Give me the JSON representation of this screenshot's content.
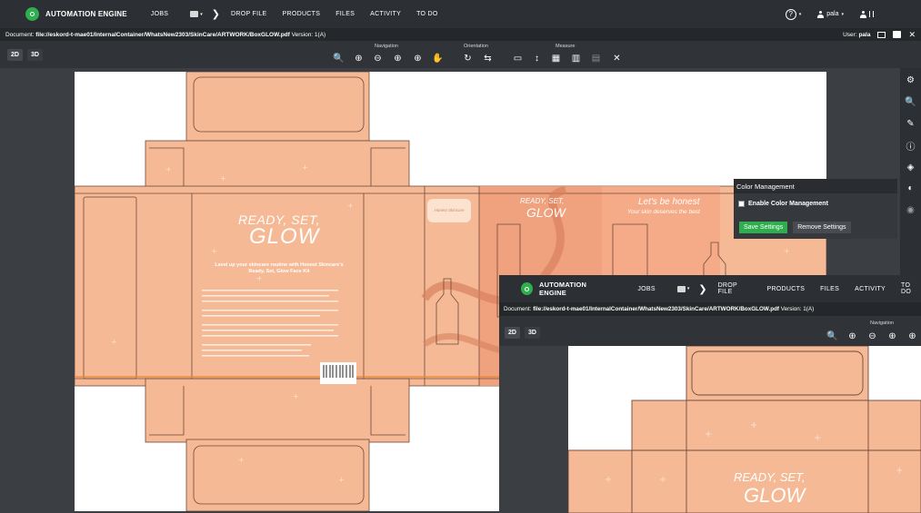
{
  "app": {
    "logo_text": "AUTOMATION ENGINE",
    "nav": [
      "JOBS",
      "DROP FILE",
      "PRODUCTS",
      "FILES",
      "ACTIVITY",
      "TO DO"
    ],
    "user": "pala",
    "chevron": "❯",
    "help_glyph": "?",
    "caret": "▾"
  },
  "docbar": {
    "label": "Document:",
    "path": "file://eskord-t-mae01/InternalContainer/WhatsNew2303/SkinCare/ARTWORK/BoxGLOW.pdf",
    "version": "Version: 1(A)",
    "user_label": "User:",
    "user": "pala",
    "close": "✕"
  },
  "toolbar": {
    "view_2d": "2D",
    "view_3d": "3D",
    "groups": [
      "Navigation",
      "Orientation",
      "Measure"
    ],
    "nav_icons": [
      "🔍",
      "⊕",
      "⊖",
      "⊕",
      "⊕",
      "✋"
    ],
    "orient_icons": [
      "↻",
      "⇆"
    ],
    "measure_icons": [
      "▭",
      "↕",
      "▦",
      "▥",
      "▤",
      "✕"
    ]
  },
  "rightbar_icons": [
    "⚙",
    "🔍",
    "✎",
    "ⓘ",
    "◈",
    "◐",
    "◉"
  ],
  "artwork": {
    "headline_top": "READY, SET,",
    "headline": "GLOW",
    "tagline": "Level up your skincare routine with Honest Skincare's Ready, Set, Glow Face Kit",
    "side_top": "READY, SET,",
    "side_headline": "GLOW",
    "honest_title": "Let's be honest",
    "honest_sub": "Your skin deserves the best",
    "brand": "Honest Skincare"
  },
  "color_mgmt": {
    "title": "Color Management",
    "checkbox": "Enable Color Management",
    "save": "Save Settings",
    "remove": "Remove Settings"
  },
  "inset": {
    "logo_text": "AUTOMATION ENGINE",
    "nav": [
      "JOBS",
      "DROP FILE",
      "PRODUCTS",
      "FILES",
      "ACTIVITY",
      "TO DO"
    ],
    "doc_label": "Document:",
    "doc_path": "file://eskord-t-mae01/InternalContainer/WhatsNew2303/SkinCare/ARTWORK/BoxGLOW.pdf",
    "version": "Version: 1(A)",
    "view_2d": "2D",
    "view_3d": "3D",
    "nav_label": "Navigation",
    "chevron": "❯",
    "nav_icons": [
      "🔍",
      "⊕",
      "⊖",
      "⊕",
      "⊕"
    ],
    "headline_top": "READY, SET,",
    "headline": "GLOW"
  },
  "colors": {
    "accent_green": "#2fae4f",
    "box_peach": "#f6b995",
    "topbar": "#2c2f33"
  }
}
